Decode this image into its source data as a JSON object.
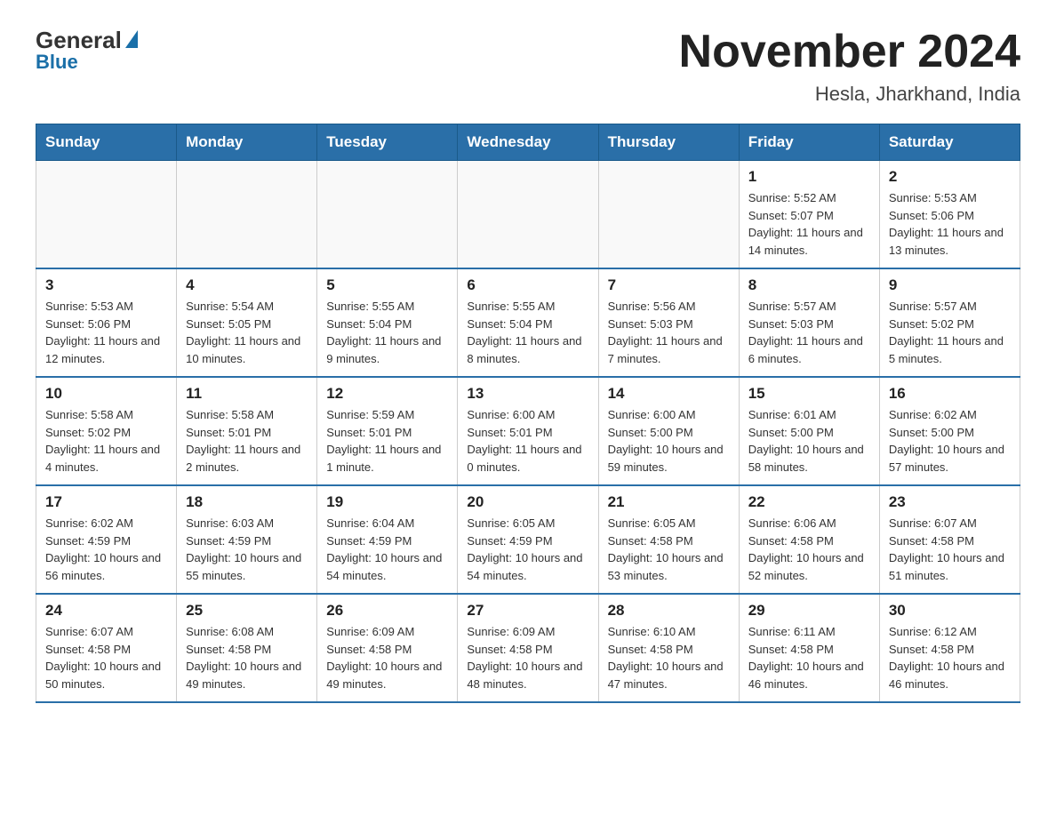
{
  "logo": {
    "general": "General",
    "blue": "Blue"
  },
  "header": {
    "month_title": "November 2024",
    "location": "Hesla, Jharkhand, India"
  },
  "weekdays": [
    "Sunday",
    "Monday",
    "Tuesday",
    "Wednesday",
    "Thursday",
    "Friday",
    "Saturday"
  ],
  "weeks": [
    [
      {
        "day": "",
        "sunrise": "",
        "sunset": "",
        "daylight": ""
      },
      {
        "day": "",
        "sunrise": "",
        "sunset": "",
        "daylight": ""
      },
      {
        "day": "",
        "sunrise": "",
        "sunset": "",
        "daylight": ""
      },
      {
        "day": "",
        "sunrise": "",
        "sunset": "",
        "daylight": ""
      },
      {
        "day": "",
        "sunrise": "",
        "sunset": "",
        "daylight": ""
      },
      {
        "day": "1",
        "sunrise": "Sunrise: 5:52 AM",
        "sunset": "Sunset: 5:07 PM",
        "daylight": "Daylight: 11 hours and 14 minutes."
      },
      {
        "day": "2",
        "sunrise": "Sunrise: 5:53 AM",
        "sunset": "Sunset: 5:06 PM",
        "daylight": "Daylight: 11 hours and 13 minutes."
      }
    ],
    [
      {
        "day": "3",
        "sunrise": "Sunrise: 5:53 AM",
        "sunset": "Sunset: 5:06 PM",
        "daylight": "Daylight: 11 hours and 12 minutes."
      },
      {
        "day": "4",
        "sunrise": "Sunrise: 5:54 AM",
        "sunset": "Sunset: 5:05 PM",
        "daylight": "Daylight: 11 hours and 10 minutes."
      },
      {
        "day": "5",
        "sunrise": "Sunrise: 5:55 AM",
        "sunset": "Sunset: 5:04 PM",
        "daylight": "Daylight: 11 hours and 9 minutes."
      },
      {
        "day": "6",
        "sunrise": "Sunrise: 5:55 AM",
        "sunset": "Sunset: 5:04 PM",
        "daylight": "Daylight: 11 hours and 8 minutes."
      },
      {
        "day": "7",
        "sunrise": "Sunrise: 5:56 AM",
        "sunset": "Sunset: 5:03 PM",
        "daylight": "Daylight: 11 hours and 7 minutes."
      },
      {
        "day": "8",
        "sunrise": "Sunrise: 5:57 AM",
        "sunset": "Sunset: 5:03 PM",
        "daylight": "Daylight: 11 hours and 6 minutes."
      },
      {
        "day": "9",
        "sunrise": "Sunrise: 5:57 AM",
        "sunset": "Sunset: 5:02 PM",
        "daylight": "Daylight: 11 hours and 5 minutes."
      }
    ],
    [
      {
        "day": "10",
        "sunrise": "Sunrise: 5:58 AM",
        "sunset": "Sunset: 5:02 PM",
        "daylight": "Daylight: 11 hours and 4 minutes."
      },
      {
        "day": "11",
        "sunrise": "Sunrise: 5:58 AM",
        "sunset": "Sunset: 5:01 PM",
        "daylight": "Daylight: 11 hours and 2 minutes."
      },
      {
        "day": "12",
        "sunrise": "Sunrise: 5:59 AM",
        "sunset": "Sunset: 5:01 PM",
        "daylight": "Daylight: 11 hours and 1 minute."
      },
      {
        "day": "13",
        "sunrise": "Sunrise: 6:00 AM",
        "sunset": "Sunset: 5:01 PM",
        "daylight": "Daylight: 11 hours and 0 minutes."
      },
      {
        "day": "14",
        "sunrise": "Sunrise: 6:00 AM",
        "sunset": "Sunset: 5:00 PM",
        "daylight": "Daylight: 10 hours and 59 minutes."
      },
      {
        "day": "15",
        "sunrise": "Sunrise: 6:01 AM",
        "sunset": "Sunset: 5:00 PM",
        "daylight": "Daylight: 10 hours and 58 minutes."
      },
      {
        "day": "16",
        "sunrise": "Sunrise: 6:02 AM",
        "sunset": "Sunset: 5:00 PM",
        "daylight": "Daylight: 10 hours and 57 minutes."
      }
    ],
    [
      {
        "day": "17",
        "sunrise": "Sunrise: 6:02 AM",
        "sunset": "Sunset: 4:59 PM",
        "daylight": "Daylight: 10 hours and 56 minutes."
      },
      {
        "day": "18",
        "sunrise": "Sunrise: 6:03 AM",
        "sunset": "Sunset: 4:59 PM",
        "daylight": "Daylight: 10 hours and 55 minutes."
      },
      {
        "day": "19",
        "sunrise": "Sunrise: 6:04 AM",
        "sunset": "Sunset: 4:59 PM",
        "daylight": "Daylight: 10 hours and 54 minutes."
      },
      {
        "day": "20",
        "sunrise": "Sunrise: 6:05 AM",
        "sunset": "Sunset: 4:59 PM",
        "daylight": "Daylight: 10 hours and 54 minutes."
      },
      {
        "day": "21",
        "sunrise": "Sunrise: 6:05 AM",
        "sunset": "Sunset: 4:58 PM",
        "daylight": "Daylight: 10 hours and 53 minutes."
      },
      {
        "day": "22",
        "sunrise": "Sunrise: 6:06 AM",
        "sunset": "Sunset: 4:58 PM",
        "daylight": "Daylight: 10 hours and 52 minutes."
      },
      {
        "day": "23",
        "sunrise": "Sunrise: 6:07 AM",
        "sunset": "Sunset: 4:58 PM",
        "daylight": "Daylight: 10 hours and 51 minutes."
      }
    ],
    [
      {
        "day": "24",
        "sunrise": "Sunrise: 6:07 AM",
        "sunset": "Sunset: 4:58 PM",
        "daylight": "Daylight: 10 hours and 50 minutes."
      },
      {
        "day": "25",
        "sunrise": "Sunrise: 6:08 AM",
        "sunset": "Sunset: 4:58 PM",
        "daylight": "Daylight: 10 hours and 49 minutes."
      },
      {
        "day": "26",
        "sunrise": "Sunrise: 6:09 AM",
        "sunset": "Sunset: 4:58 PM",
        "daylight": "Daylight: 10 hours and 49 minutes."
      },
      {
        "day": "27",
        "sunrise": "Sunrise: 6:09 AM",
        "sunset": "Sunset: 4:58 PM",
        "daylight": "Daylight: 10 hours and 48 minutes."
      },
      {
        "day": "28",
        "sunrise": "Sunrise: 6:10 AM",
        "sunset": "Sunset: 4:58 PM",
        "daylight": "Daylight: 10 hours and 47 minutes."
      },
      {
        "day": "29",
        "sunrise": "Sunrise: 6:11 AM",
        "sunset": "Sunset: 4:58 PM",
        "daylight": "Daylight: 10 hours and 46 minutes."
      },
      {
        "day": "30",
        "sunrise": "Sunrise: 6:12 AM",
        "sunset": "Sunset: 4:58 PM",
        "daylight": "Daylight: 10 hours and 46 minutes."
      }
    ]
  ]
}
